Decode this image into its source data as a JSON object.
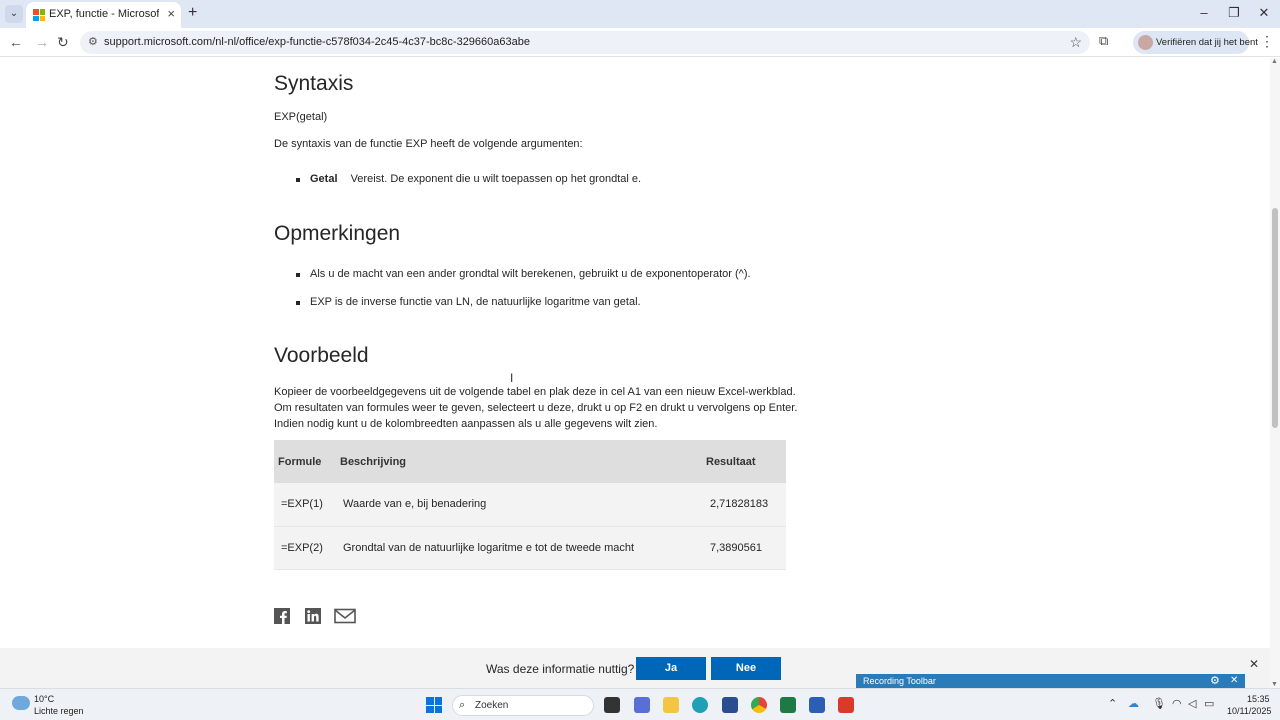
{
  "browser": {
    "tab_title": "EXP, functie - Microsoft Onders",
    "url": "support.microsoft.com/nl-nl/office/exp-functie-c578f034-2c45-4c37-bc8c-329660a63abe",
    "profile_label": "Verifiëren dat jij het bent"
  },
  "article": {
    "syntax_heading": "Syntaxis",
    "syntax_formula": "EXP(getal)",
    "syntax_intro": "De syntaxis van de functie EXP heeft de volgende argumenten:",
    "arg_name": "Getal",
    "arg_desc": "Vereist. De exponent die u wilt toepassen op het grondtal e.",
    "remarks_heading": "Opmerkingen",
    "remarks": [
      "Als u de macht van een ander grondtal wilt berekenen, gebruikt u de exponentoperator (^).",
      "EXP is de inverse functie van LN, de natuurlijke logaritme van getal."
    ],
    "example_heading": "Voorbeeld",
    "example_intro": [
      "Kopieer de voorbeeldgegevens uit de volgende tabel en plak deze in cel A1 van een nieuw Excel-werkblad.",
      "Om resultaten van formules weer te geven, selecteert u deze, drukt u op F2 en drukt u vervolgens op Enter.",
      "Indien nodig kunt u de kolombreedten aanpassen als u alle gegevens wilt zien."
    ],
    "table": {
      "headers": [
        "Formule",
        "Beschrijving",
        "Resultaat"
      ],
      "rows": [
        [
          "=EXP(1)",
          "Waarde van e, bij benadering",
          "2,71828183"
        ],
        [
          "=EXP(2)",
          "Grondtal van de natuurlijke logaritme e tot de tweede macht",
          "7,3890561"
        ]
      ]
    },
    "share_icons": [
      "facebook-icon",
      "linkedin-icon",
      "mail-icon"
    ]
  },
  "feedback": {
    "question": "Was deze informatie nuttig?",
    "yes": "Ja",
    "no": "Nee"
  },
  "recording_toolbar": {
    "label": "Recording Toolbar"
  },
  "taskbar": {
    "weather_temp": "10°C",
    "weather_desc": "Lichte regen",
    "search_placeholder": "Zoeken",
    "time": "15:35",
    "date": "10/11/2025"
  },
  "colors": {
    "accent": "#0067b8",
    "table_header": "#dedede",
    "table_alt_row": "#f3f3f3",
    "rec_toolbar": "#2b7bb9"
  }
}
